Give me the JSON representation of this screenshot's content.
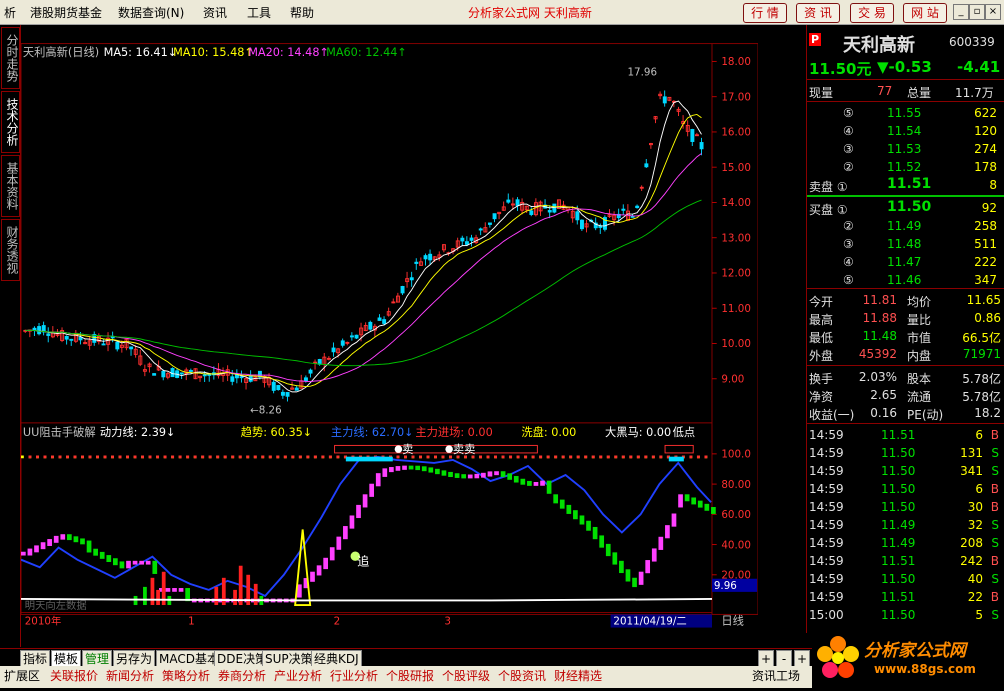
{
  "menu": {
    "items": [
      "析",
      "港股期货基金",
      "数据查询(N)",
      "资讯",
      "工具",
      "帮助"
    ],
    "headline": "分析家公式网  天利高新",
    "buttons": [
      "行 情",
      "资 讯",
      "交 易",
      "网 站"
    ]
  },
  "left_tabs": [
    "分时走势",
    "技术分析",
    "基本资料",
    "财务透视"
  ],
  "main_chart": {
    "title": "天利高新(日线)",
    "ma5": "MA5: 16.41↓",
    "ma10": "MA10: 15.48↑",
    "ma20": "MA20: 14.48↑",
    "ma60": "MA60: 12.44↑",
    "high_label": "17.96",
    "low_label": "←8.26",
    "price_axis": [
      "18.00",
      "17.00",
      "16.00",
      "15.00",
      "14.00",
      "13.00",
      "12.00",
      "11.00",
      "10.00",
      "9.00"
    ],
    "colors": {
      "ma5": "#ffffff",
      "ma10": "#ffff00",
      "ma20": "#ff40ff",
      "ma60": "#00c000",
      "up": "#ff3030",
      "down": "#00d8ff"
    }
  },
  "indicator": {
    "name": "UU阻击手破解",
    "dong": "动力线: 2.39↓",
    "qushi": "趋势: 60.35↓",
    "zhuli": "主力线: 62.70↓",
    "jinchang": "主力进场: 0.00",
    "xipan": "洗盘: 0.00",
    "dahei": "大黑马: 0.00",
    "didian": "低点",
    "chase": "追",
    "marker1": "卖",
    "marker2": "卖卖",
    "axis": [
      "100.0",
      "80.00",
      "60.00",
      "40.00",
      "20.00"
    ],
    "current": "9.96",
    "watermark": "明天向左数据"
  },
  "time_axis": {
    "year": "2010年",
    "m1": "1",
    "m2": "2",
    "m3": "3",
    "date": "2011/04/19/二",
    "period": "日线"
  },
  "quote": {
    "code_mark": "P",
    "name": "天利高新",
    "code": "600339",
    "price": "11.50元",
    "change": "▼-0.53",
    "pct": "-4.41",
    "xianliang_l": "现量",
    "xianliang": "77",
    "zongliang_l": "总量",
    "zongliang": "11.7万",
    "sell": [
      {
        "lv": "⑤",
        "p": "11.55",
        "v": "622"
      },
      {
        "lv": "④",
        "p": "11.54",
        "v": "120"
      },
      {
        "lv": "③",
        "p": "11.53",
        "v": "274"
      },
      {
        "lv": "②",
        "p": "11.52",
        "v": "178"
      },
      {
        "lv": "卖盘 ①",
        "p": "11.51",
        "v": "8"
      }
    ],
    "buy": [
      {
        "lv": "买盘 ①",
        "p": "11.50",
        "v": "92"
      },
      {
        "lv": "②",
        "p": "11.49",
        "v": "258"
      },
      {
        "lv": "③",
        "p": "11.48",
        "v": "511"
      },
      {
        "lv": "④",
        "p": "11.47",
        "v": "222"
      },
      {
        "lv": "⑤",
        "p": "11.46",
        "v": "347"
      }
    ],
    "stats": [
      {
        "a": "今开",
        "av": "11.81",
        "b": "均价",
        "bv": "11.65"
      },
      {
        "a": "最高",
        "av": "11.88",
        "b": "量比",
        "bv": "0.86"
      },
      {
        "a": "最低",
        "av": "11.48",
        "b": "市值",
        "bv": "66.5亿"
      },
      {
        "a": "外盘",
        "av": "45392",
        "b": "内盘",
        "bv": "71971"
      }
    ],
    "stats2": [
      {
        "a": "换手",
        "av": "2.03%",
        "b": "股本",
        "bv": "5.78亿"
      },
      {
        "a": "净资",
        "av": "2.65",
        "b": "流通",
        "bv": "5.78亿"
      },
      {
        "a": "收益(一)",
        "av": "0.16",
        "b": "PE(动)",
        "bv": "18.2"
      }
    ],
    "ticks": [
      {
        "t": "14:59",
        "p": "11.51",
        "v": "6",
        "s": "B"
      },
      {
        "t": "14:59",
        "p": "11.50",
        "v": "131",
        "s": "S"
      },
      {
        "t": "14:59",
        "p": "11.50",
        "v": "341",
        "s": "S"
      },
      {
        "t": "14:59",
        "p": "11.50",
        "v": "6",
        "s": "B"
      },
      {
        "t": "14:59",
        "p": "11.50",
        "v": "30",
        "s": "B"
      },
      {
        "t": "14:59",
        "p": "11.49",
        "v": "32",
        "s": "S"
      },
      {
        "t": "14:59",
        "p": "11.49",
        "v": "208",
        "s": "S"
      },
      {
        "t": "14:59",
        "p": "11.51",
        "v": "242",
        "s": "B"
      },
      {
        "t": "14:59",
        "p": "11.50",
        "v": "40",
        "s": "S"
      },
      {
        "t": "14:59",
        "p": "11.51",
        "v": "22",
        "s": "B"
      },
      {
        "t": "15:00",
        "p": "11.50",
        "v": "5",
        "s": "S"
      }
    ]
  },
  "bottom_tabs1": [
    "指标",
    "模板",
    "管理",
    "另存为",
    "MACD基本",
    "DDE决策",
    "SUP决策",
    "经典KDJ"
  ],
  "bottom_ctrl": [
    "+",
    "-",
    "+"
  ],
  "bottom_tabs2": [
    "扩展区",
    "关联报价",
    "新闻分析",
    "策略分析",
    "券商分析",
    "产业分析",
    "行业分析",
    "个股研报",
    "个股评级",
    "个股资讯",
    "财经精选",
    "资讯工场"
  ],
  "logo": {
    "text": "分析家公式网",
    "url": "www.88gs.com"
  }
}
